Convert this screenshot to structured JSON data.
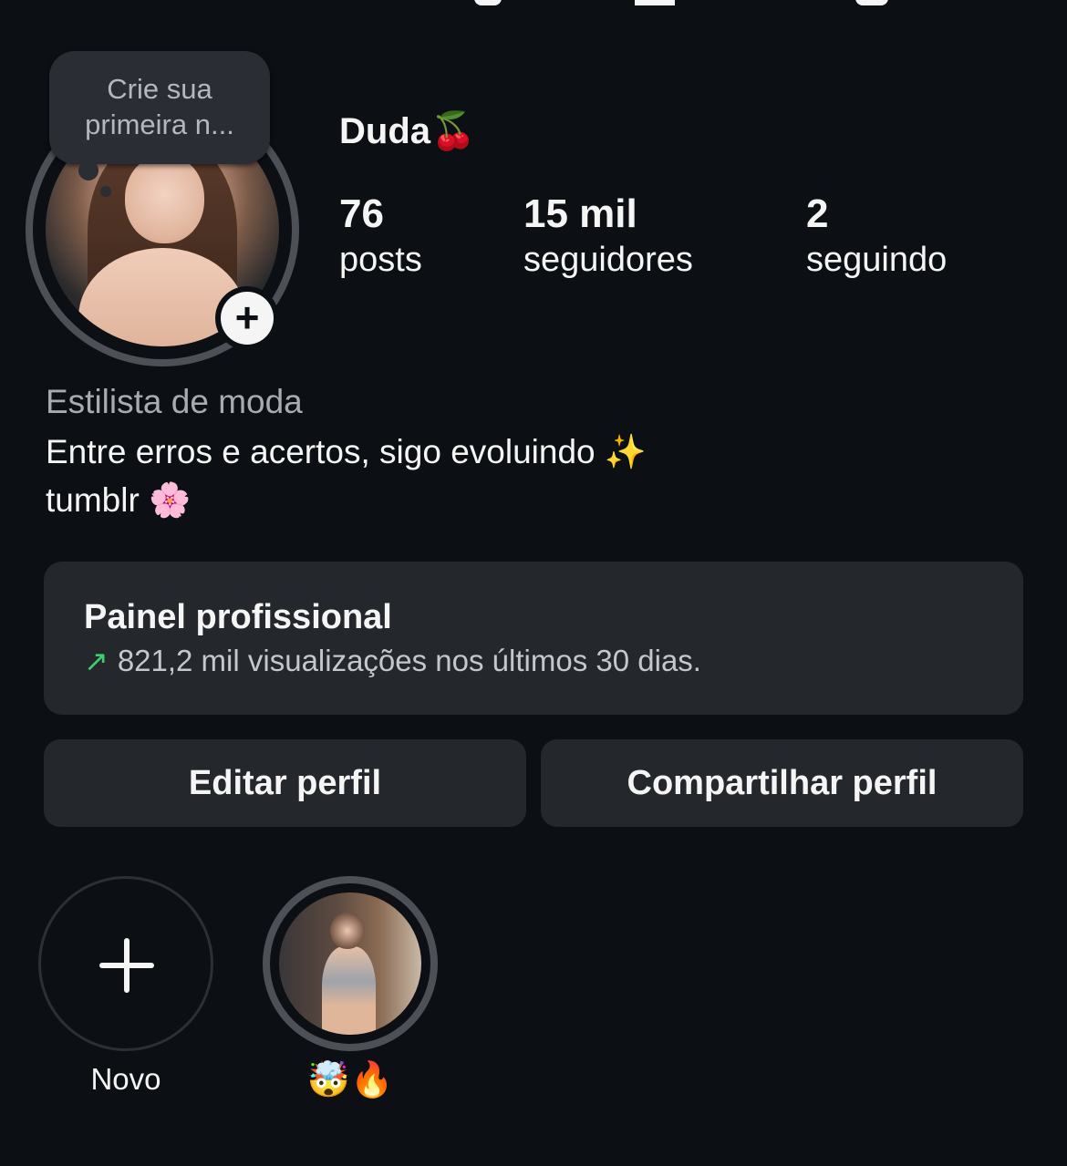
{
  "note": {
    "text": "Crie sua primeira n..."
  },
  "profile": {
    "name": "Duda",
    "name_emoji": "🍒",
    "category": "Estilista de moda",
    "bio_line_1": "Entre erros e acertos, sigo evoluindo",
    "bio_line_1_emoji": "✨",
    "bio_line_2": "tumblr",
    "bio_line_2_emoji": "🌸"
  },
  "stats": [
    {
      "value": "76",
      "label": "posts"
    },
    {
      "value": "15 mil",
      "label": "seguidores"
    },
    {
      "value": "2",
      "label": "seguindo"
    }
  ],
  "pro_dashboard": {
    "title": "Painel profissional",
    "arrow_glyph": "↗",
    "subtitle": "821,2 mil visualizações nos últimos 30 dias.",
    "accent_color": "#3ccf6e"
  },
  "buttons": {
    "edit_profile": "Editar perfil",
    "share_profile": "Compartilhar perfil"
  },
  "highlights": {
    "new_label": "Novo",
    "story_label_emoji_1": "🤯",
    "story_label_emoji_2": "🔥"
  },
  "icons": {
    "add_story": "plus-icon",
    "new_highlight": "plus-icon",
    "trend": "arrow-up-right-icon"
  },
  "colors": {
    "background": "#0c1014",
    "card": "#24272c",
    "ring": "#4d5056",
    "text": "#f5f5f5",
    "muted": "#a8abb0"
  }
}
